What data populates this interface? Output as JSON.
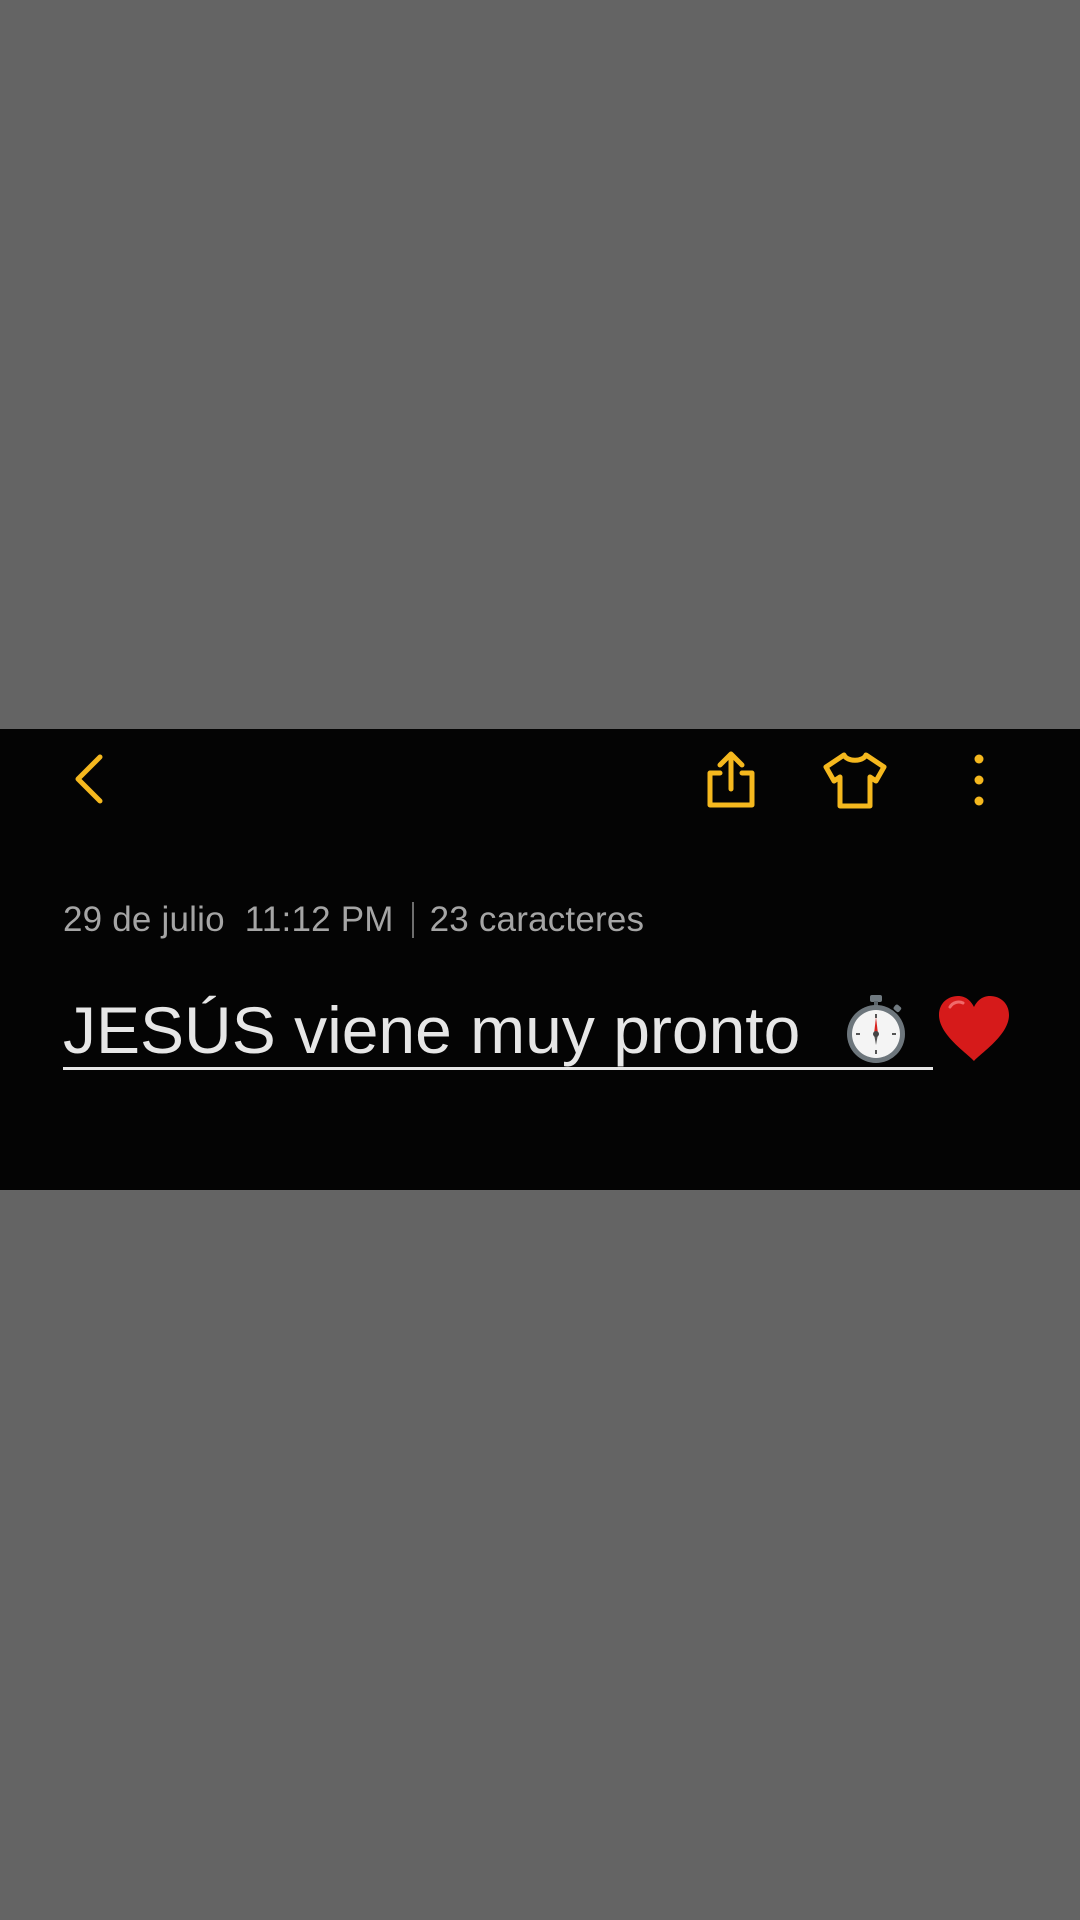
{
  "colors": {
    "backdrop": "#646464",
    "card_background": "#040404",
    "accent": "#f5b81e",
    "meta_text": "#a5a5a5",
    "title_text": "#e6e6e6"
  },
  "toolbar": {
    "back_icon": "chevron-left-icon",
    "share_icon": "share-icon",
    "theme_icon": "shirt-icon",
    "more_icon": "more-vertical-icon"
  },
  "meta": {
    "date": "29 de julio",
    "time": "11:12 PM",
    "char_count": "23 caracteres"
  },
  "note": {
    "title": "JESÚS viene muy pronto",
    "emoji_icons": [
      "stopwatch-icon",
      "red-heart-icon"
    ]
  }
}
